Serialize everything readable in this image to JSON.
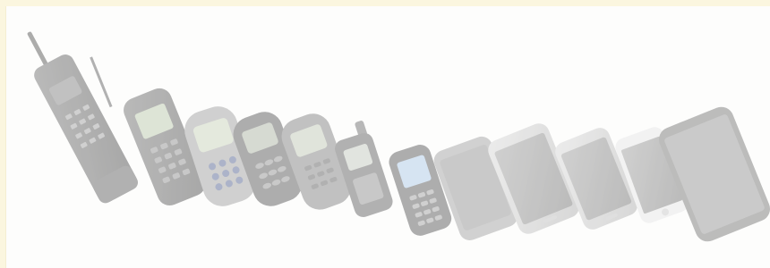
{
  "image": {
    "subject": "phones-evolution",
    "phones": [
      {
        "kind": "brick-phone",
        "id": "p1"
      },
      {
        "kind": "candybar-antenna",
        "id": "p2"
      },
      {
        "kind": "candybar-keypad-blue",
        "id": "p3"
      },
      {
        "kind": "candybar-keypad-dark",
        "id": "p4"
      },
      {
        "kind": "candybar-keypad-grey",
        "id": "p5"
      },
      {
        "kind": "compact-stub-antenna",
        "id": "p6"
      },
      {
        "kind": "feature-phone-color-screen",
        "id": "p7"
      },
      {
        "kind": "early-smartphone",
        "id": "p8"
      },
      {
        "kind": "smartphone-white",
        "id": "p9"
      },
      {
        "kind": "smartphone-white-2",
        "id": "p10"
      },
      {
        "kind": "smartphone-small-white",
        "id": "p11"
      },
      {
        "kind": "smartphone-large-dark",
        "id": "p12"
      }
    ],
    "colors": {
      "background": "#fbf6df",
      "panel": "#fdfdfc",
      "phone_dark": "#5b5b5b",
      "phone_mid": "#8d8d8d",
      "screen_blue": "#a9c6e6"
    }
  }
}
